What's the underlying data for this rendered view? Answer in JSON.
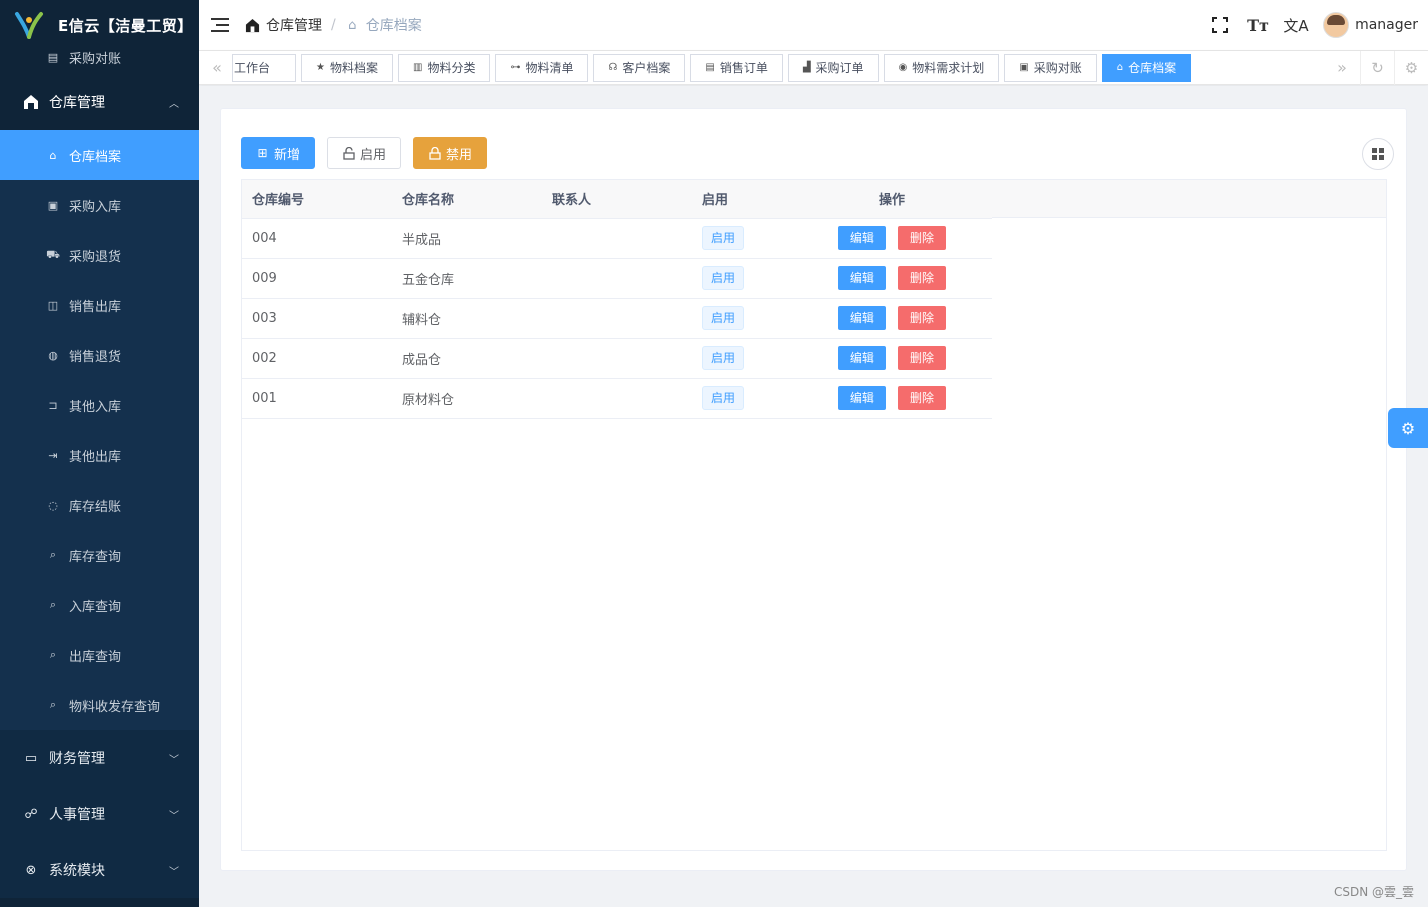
{
  "app": {
    "logo_text": "E信云【洁曼工贸】"
  },
  "sidebar": {
    "partial_item": {
      "label": "采购对账",
      "icon": "ledger-icon"
    },
    "open_group": {
      "label": "仓库管理",
      "icon": "warehouse-icon"
    },
    "items": [
      {
        "label": "仓库档案",
        "icon": "warehouse-archive-icon",
        "active": true
      },
      {
        "label": "采购入库",
        "icon": "inbox-in-icon"
      },
      {
        "label": "采购退货",
        "icon": "return-truck-icon"
      },
      {
        "label": "销售出库",
        "icon": "cart-out-icon"
      },
      {
        "label": "销售退货",
        "icon": "refund-icon"
      },
      {
        "label": "其他入库",
        "icon": "door-in-icon"
      },
      {
        "label": "其他出库",
        "icon": "door-out-icon"
      },
      {
        "label": "库存结账",
        "icon": "settle-icon"
      },
      {
        "label": "库存查询",
        "icon": "search-stock-icon"
      },
      {
        "label": "入库查询",
        "icon": "search-in-icon"
      },
      {
        "label": "出库查询",
        "icon": "search-out-icon"
      },
      {
        "label": "物料收发存查询",
        "icon": "search-flow-icon"
      }
    ],
    "groups": [
      {
        "label": "财务管理",
        "icon": "finance-icon"
      },
      {
        "label": "人事管理",
        "icon": "hr-icon"
      },
      {
        "label": "系统模块",
        "icon": "system-icon"
      }
    ]
  },
  "header": {
    "breadcrumb": [
      {
        "label": "仓库管理",
        "icon": "home-icon"
      },
      {
        "label": "仓库档案",
        "icon": "warehouse-archive-icon"
      }
    ],
    "username": "manager"
  },
  "tags": [
    {
      "label": "工作台"
    },
    {
      "label": "物料档案",
      "icon": "star-icon"
    },
    {
      "label": "物料分类",
      "icon": "barcode-icon"
    },
    {
      "label": "物料清单",
      "icon": "tree-icon"
    },
    {
      "label": "客户档案",
      "icon": "users-icon"
    },
    {
      "label": "销售订单",
      "icon": "doc-icon"
    },
    {
      "label": "采购订单",
      "icon": "chart-icon"
    },
    {
      "label": "物料需求计划",
      "icon": "target-icon"
    },
    {
      "label": "采购对账",
      "icon": "ledger-icon"
    },
    {
      "label": "仓库档案",
      "icon": "warehouse-archive-icon",
      "active": true
    }
  ],
  "toolbar": {
    "add_label": "新增",
    "enable_label": "启用",
    "disable_label": "禁用"
  },
  "table": {
    "columns": [
      "仓库编号",
      "仓库名称",
      "联系人",
      "启用",
      "操作"
    ],
    "rows": [
      {
        "code": "004",
        "name": "半成品",
        "contact": "",
        "status": "启用"
      },
      {
        "code": "009",
        "name": "五金仓库",
        "contact": "",
        "status": "启用"
      },
      {
        "code": "003",
        "name": "辅料仓",
        "contact": "",
        "status": "启用"
      },
      {
        "code": "002",
        "name": "成品仓",
        "contact": "",
        "status": "启用"
      },
      {
        "code": "001",
        "name": "原材料仓",
        "contact": "",
        "status": "启用"
      }
    ],
    "edit_label": "编辑",
    "delete_label": "删除"
  },
  "footer_credit": "CSDN @雲_雲",
  "colors": {
    "primary": "#409eff",
    "warning": "#e6a23c",
    "danger": "#f56c6c",
    "sidebar_bg": "#0f2438"
  }
}
